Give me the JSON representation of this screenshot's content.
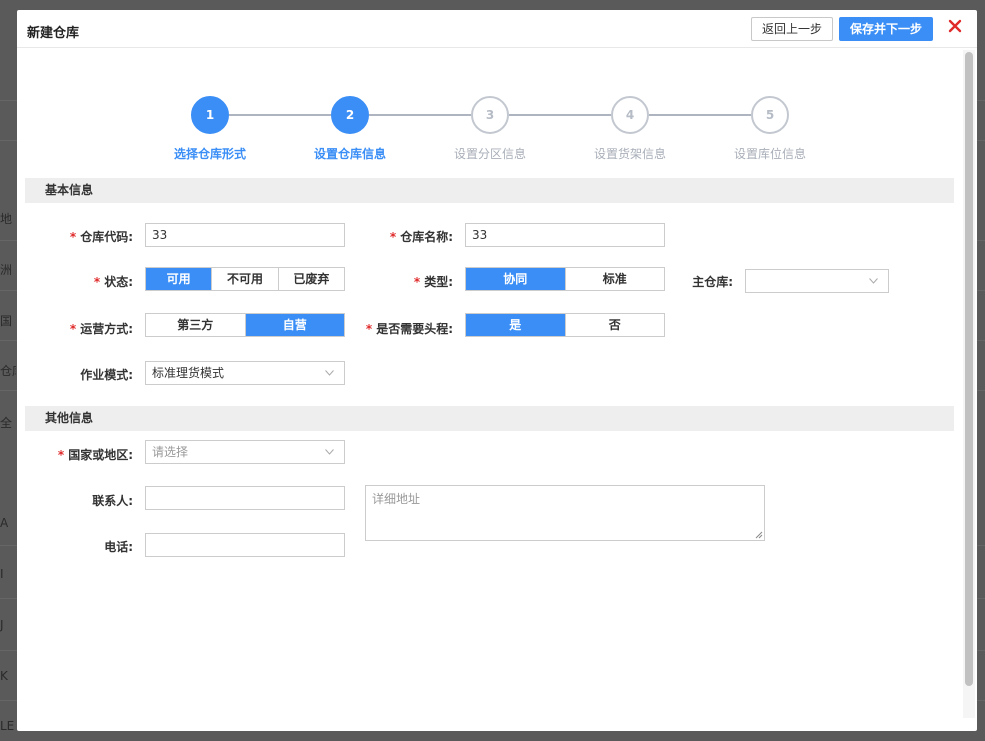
{
  "background": {
    "left_fragments": [
      "地",
      "洲",
      "国",
      "仓库",
      "全",
      "A",
      "I",
      "J",
      "K",
      "LE"
    ]
  },
  "modal": {
    "title": "新建仓库",
    "prev_button": "返回上一步",
    "next_button": "保存并下一步",
    "close_icon": "close-icon"
  },
  "steps": [
    {
      "number": "1",
      "label": "选择仓库形式",
      "state": "active"
    },
    {
      "number": "2",
      "label": "设置仓库信息",
      "state": "active"
    },
    {
      "number": "3",
      "label": "设置分区信息",
      "state": "inactive"
    },
    {
      "number": "4",
      "label": "设置货架信息",
      "state": "inactive"
    },
    {
      "number": "5",
      "label": "设置库位信息",
      "state": "inactive"
    }
  ],
  "basic": {
    "section_title": "基本信息",
    "code_label": "仓库代码:",
    "code_value": "33",
    "name_label": "仓库名称:",
    "name_value": "33",
    "status_label": "状态:",
    "status_options": [
      "可用",
      "不可用",
      "已废弃"
    ],
    "status_selected": "可用",
    "type_label": "类型:",
    "type_options": [
      "协同",
      "标准"
    ],
    "type_selected": "协同",
    "main_wh_label": "主仓库:",
    "main_wh_value": "",
    "ops_label": "运营方式:",
    "ops_options": [
      "第三方",
      "自营"
    ],
    "ops_selected": "自营",
    "head_label": "是否需要头程:",
    "head_options": [
      "是",
      "否"
    ],
    "head_selected": "是",
    "mode_label": "作业模式:",
    "mode_value": "标准理货模式"
  },
  "other": {
    "section_title": "其他信息",
    "country_label": "国家或地区:",
    "country_placeholder": "请选择",
    "contact_label": "联系人:",
    "contact_value": "",
    "phone_label": "电话:",
    "phone_value": "",
    "address_placeholder": "详细地址"
  },
  "colors": {
    "accent": "#3a8ef6",
    "required": "#e02a2a",
    "close": "#e02a2a"
  }
}
